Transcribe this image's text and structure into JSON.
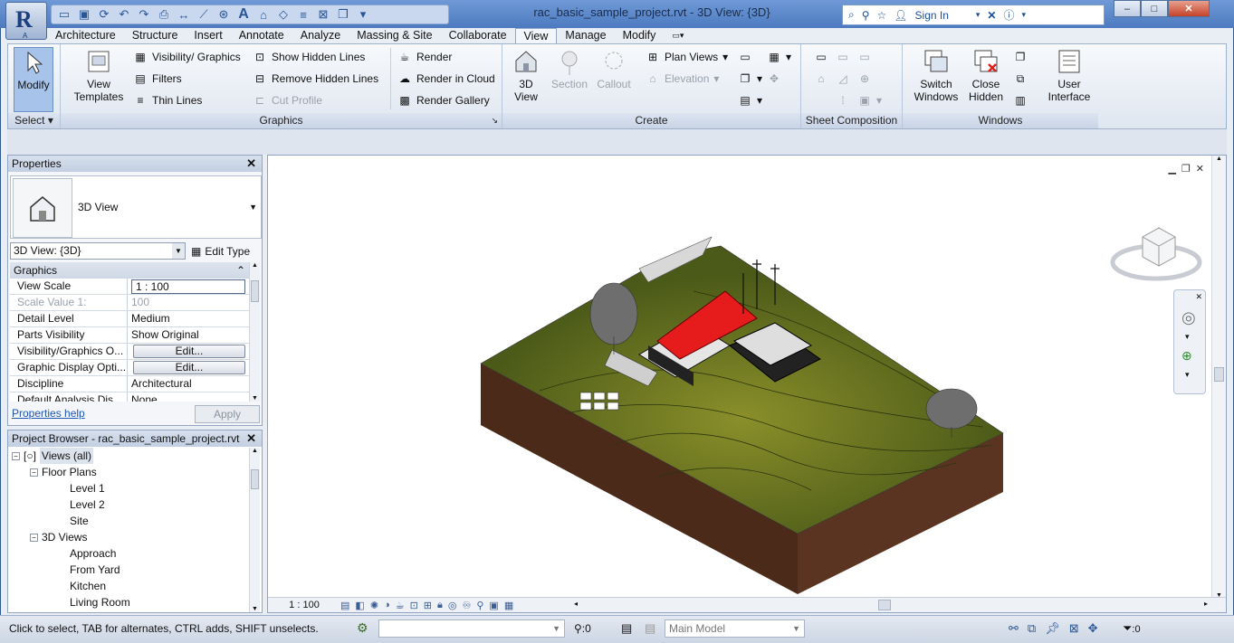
{
  "titlebar": {
    "title": "rac_basic_sample_project.rvt - 3D View: {3D}",
    "signin": "Sign In",
    "app_letter": "R",
    "app_sub": "A"
  },
  "tabs": [
    "Architecture",
    "Structure",
    "Insert",
    "Annotate",
    "Analyze",
    "Massing & Site",
    "Collaborate",
    "View",
    "Manage",
    "Modify"
  ],
  "active_tab": "View",
  "ribbon": {
    "select": {
      "modify": "Modify",
      "title": "Select"
    },
    "graphics": {
      "view_templates": "View\nTemplates",
      "visibility_graphics": "Visibility/ Graphics",
      "filters": "Filters",
      "thin_lines": "Thin  Lines",
      "show_hidden": "Show  Hidden Lines",
      "remove_hidden": "Remove  Hidden Lines",
      "cut_profile": "Cut  Profile",
      "render": "Render",
      "render_cloud": "Render  in Cloud",
      "render_gallery": "Render  Gallery",
      "title": "Graphics"
    },
    "create": {
      "view3d": "3D\nView",
      "section": "Section",
      "callout": "Callout",
      "plan_views": "Plan  Views",
      "elevation": "Elevation",
      "title": "Create"
    },
    "sheet": {
      "title": "Sheet Composition"
    },
    "windows": {
      "switch": "Switch\nWindows",
      "close_hidden": "Close\nHidden",
      "user_interface": "User\nInterface",
      "title": "Windows"
    }
  },
  "properties": {
    "header": "Properties",
    "type_name": "3D View",
    "instance": "3D View: {3D}",
    "edit_type": "Edit Type",
    "section": "Graphics",
    "rows": [
      {
        "k": "View Scale",
        "v": "1 : 100"
      },
      {
        "k": "Scale Value    1:",
        "v": "100"
      },
      {
        "k": "Detail Level",
        "v": "Medium"
      },
      {
        "k": "Parts Visibility",
        "v": "Show Original"
      },
      {
        "k": "Visibility/Graphics O...",
        "v": "Edit..."
      },
      {
        "k": "Graphic Display Opti...",
        "v": "Edit..."
      },
      {
        "k": "Discipline",
        "v": "Architectural"
      },
      {
        "k": "Default Analysis Dis...",
        "v": "None"
      }
    ],
    "help": "Properties help",
    "apply": "Apply"
  },
  "browser": {
    "header": "Project Browser - rac_basic_sample_project.rvt",
    "root": "Views (all)",
    "floor_plans": "Floor Plans",
    "fp": [
      "Level 1",
      "Level 2",
      "Site"
    ],
    "views3d": "3D Views",
    "v3d": [
      "Approach",
      "From Yard",
      "Kitchen",
      "Living Room"
    ]
  },
  "viewport": {
    "scale": "1 : 100"
  },
  "status": {
    "text": "Click to select, TAB for alternates, CTRL adds, SHIFT unselects.",
    "count": ":0",
    "model": "Main Model",
    "filter": ":0"
  }
}
